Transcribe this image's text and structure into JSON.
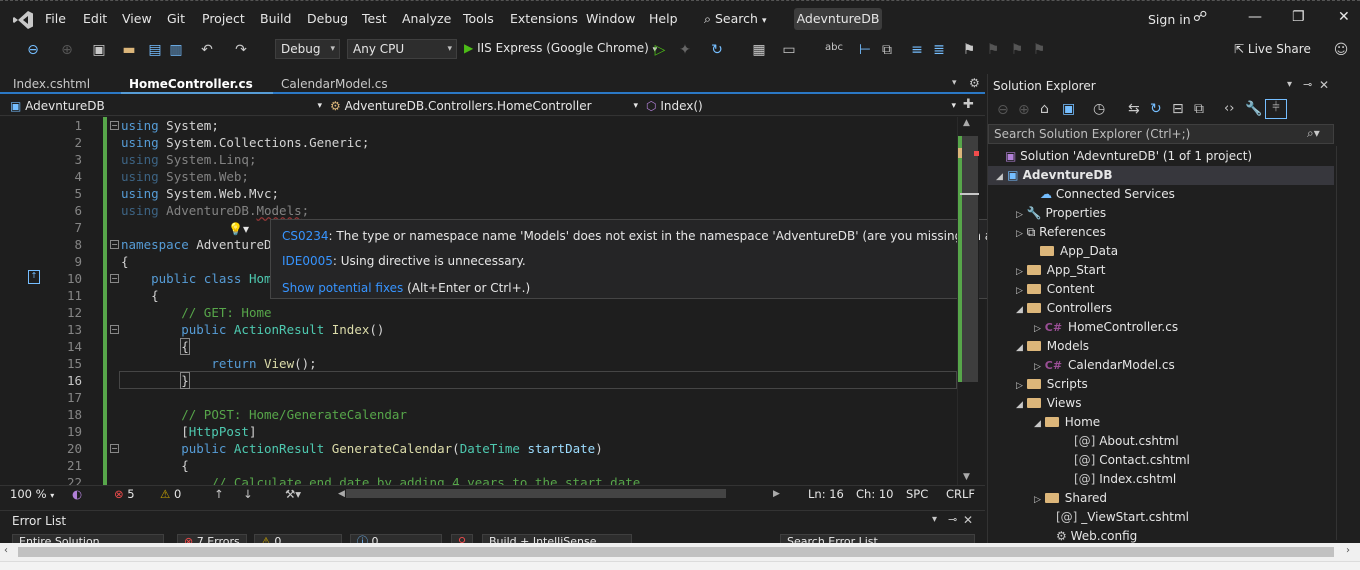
{
  "menubar": {
    "items": [
      "File",
      "Edit",
      "View",
      "Git",
      "Project",
      "Build",
      "Debug",
      "Test",
      "Analyze",
      "Tools",
      "Extensions",
      "Window",
      "Help"
    ],
    "search": "Search",
    "solution": "AdevntureDB",
    "signin": "Sign in"
  },
  "toolbar": {
    "config": "Debug",
    "platform": "Any CPU",
    "run": "IIS Express (Google Chrome)",
    "liveshare": "Live Share"
  },
  "tabs": [
    {
      "label": "Index.cshtml"
    },
    {
      "label": "HomeController.cs"
    },
    {
      "label": "CalendarModel.cs"
    }
  ],
  "navbar": {
    "project": "AdevntureDB",
    "class": "AdventureDB.Controllers.HomeController",
    "member": "Index()"
  },
  "code": {
    "lines": [
      "1",
      "2",
      "3",
      "4",
      "5",
      "6",
      "7",
      "8",
      "9",
      "10",
      "11",
      "12",
      "13",
      "14",
      "15",
      "16",
      "17",
      "18",
      "19",
      "20",
      "21",
      "22"
    ]
  },
  "tooltip": {
    "code1": "CS0234",
    "msg1": ": The type or namespace name 'Models' does not exist in the namespace 'AdventureDB' (are you missing an assembly reference?)",
    "code2": "IDE0005",
    "msg2": ": Using directive is unnecessary.",
    "fix": "Show potential fixes",
    "fix_keys": " (Alt+Enter or Ctrl+.)"
  },
  "status": {
    "zoom": "100 %",
    "errors": "5",
    "warnings": "0",
    "line": "Ln: 16",
    "col": "Ch: 10",
    "spacing": "SPC",
    "eol": "CRLF"
  },
  "errorlist": {
    "title": "Error List",
    "scope": "Entire Solution",
    "errors": "7 Errors",
    "warnings": "0 Warnings",
    "messages": "0 Messages",
    "filter": "Build + IntelliSense",
    "search": "Search Error List"
  },
  "solution_explorer": {
    "title": "Solution Explorer",
    "search": "Search Solution Explorer (Ctrl+;)",
    "solution": "Solution 'AdevntureDB' (1 of 1 project)",
    "project": "AdevntureDB",
    "items": [
      "Connected Services",
      "Properties",
      "References",
      "App_Data",
      "App_Start",
      "Content",
      "Controllers",
      "HomeController.cs",
      "Models",
      "CalendarModel.cs",
      "Scripts",
      "Views",
      "Home",
      "About.cshtml",
      "Contact.cshtml",
      "Index.cshtml",
      "Shared",
      "_ViewStart.cshtml",
      "Web.config"
    ]
  }
}
